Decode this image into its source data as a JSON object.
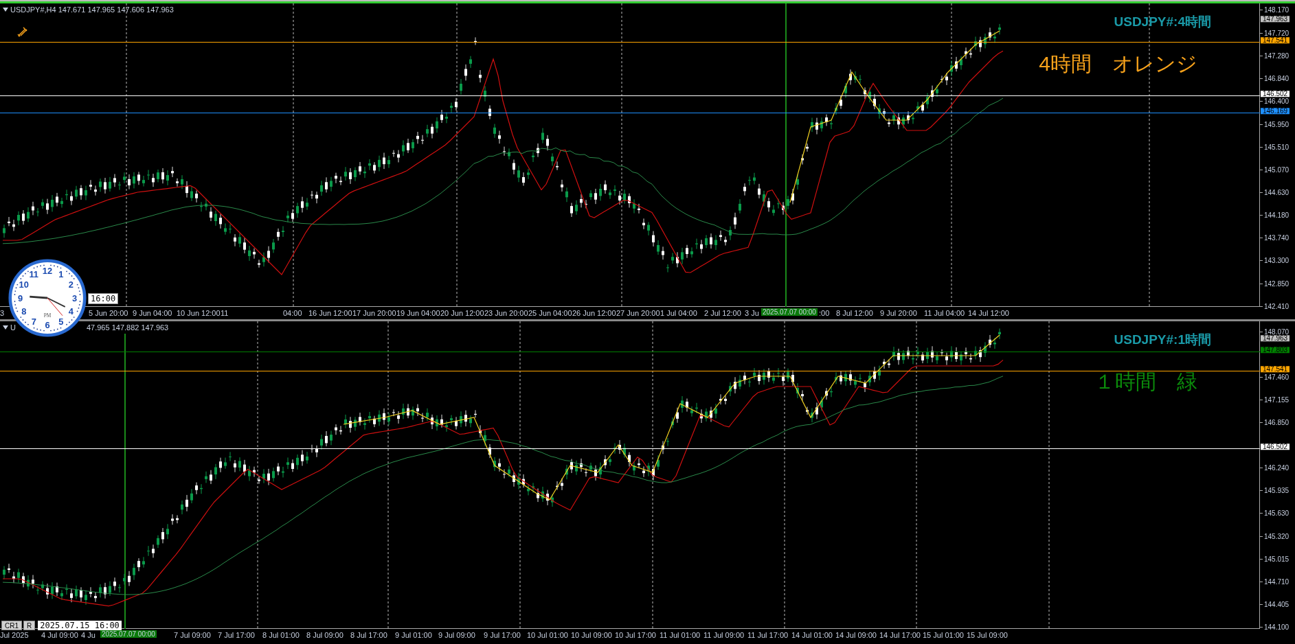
{
  "panels": [
    {
      "symbol": "USDJPY#,H4",
      "ohlc": "147.671 147.965 147.606 147.963",
      "title": "USDJPY#:4時間",
      "note": "4時間　オレンジ",
      "color": "#f7a21b",
      "current_price": "147.963",
      "crosshair_label": "2025.07.07 00:00",
      "price_ticks": [
        "148.170",
        "147.720",
        "147.280",
        "146.840",
        "146.400",
        "145.950",
        "145.510",
        "145.070",
        "144.630",
        "144.180",
        "143.740",
        "143.300",
        "142.850",
        "142.410"
      ],
      "price_lines": [
        {
          "price": "147.541",
          "color": "#ffa500"
        },
        {
          "price": "146.502",
          "color": "#ffffff"
        },
        {
          "price": "146.169",
          "color": "#1e90ff"
        }
      ],
      "time_labels": [
        "3",
        "5 Jun 20:00",
        "9 Jun 04:00",
        "10 Jun 12:00",
        "11",
        "04:00",
        "16 Jun 12:00",
        "17 Jun 20:00",
        "19 Jun 04:00",
        "20 Jun 12:00",
        "23 Jun 20:00",
        "25 Jun 04:00",
        "26 Jun 12:00",
        "27 Jun 20:00",
        "1 Jul 04:00",
        "2 Jul 12:00",
        "3 Ju",
        ":00",
        "8 Jul 12:00",
        "9 Jul 20:00",
        "11 Jul 04:00",
        "14 Jul 12:00"
      ]
    },
    {
      "symbol": "U",
      "ohlc": "47.965 147.882 147.963",
      "title": "USDJPY#:1時間",
      "note": "１時間　緑",
      "color": "#0b8a0b",
      "current_price": "147.963",
      "crosshair_label": "2025.07.07 00:00",
      "price_ticks": [
        "148.070",
        "147.460",
        "147.155",
        "146.850",
        "146.240",
        "145.935",
        "145.630",
        "145.320",
        "145.015",
        "144.710",
        "144.405",
        "144.100"
      ],
      "price_lines": [
        {
          "price": "147.803",
          "color": "#008000"
        },
        {
          "price": "147.541",
          "color": "#ffa500"
        },
        {
          "price": "146.502",
          "color": "#ffffff"
        }
      ],
      "time_labels": [
        "Jul 2025",
        "4 Jul 09:00",
        "4 Ju",
        "7 Jul 09:00",
        "7 Jul 17:00",
        "8 Jul 01:00",
        "8 Jul 09:00",
        "8 Jul 17:00",
        "9 Jul 01:00",
        "9 Jul 09:00",
        "9 Jul 17:00",
        "10 Jul 01:00",
        "10 Jul 09:00",
        "10 Jul 17:00",
        "11 Jul 01:00",
        "11 Jul 09:00",
        "11 Jul 17:00",
        "14 Jul 01:00",
        "14 Jul 09:00",
        "14 Jul 17:00",
        "15 Jul 01:00",
        "15 Jul 09:00"
      ]
    }
  ],
  "clock": {
    "numbers": [
      "12",
      "11",
      "1",
      "10",
      "2",
      "9",
      "3",
      "8",
      "4",
      "7",
      "5",
      "6"
    ],
    "period": "PM",
    "time": "16:00"
  },
  "tabs": [
    "CR1",
    "R"
  ],
  "status_time": "2025.07.15 16:00"
}
